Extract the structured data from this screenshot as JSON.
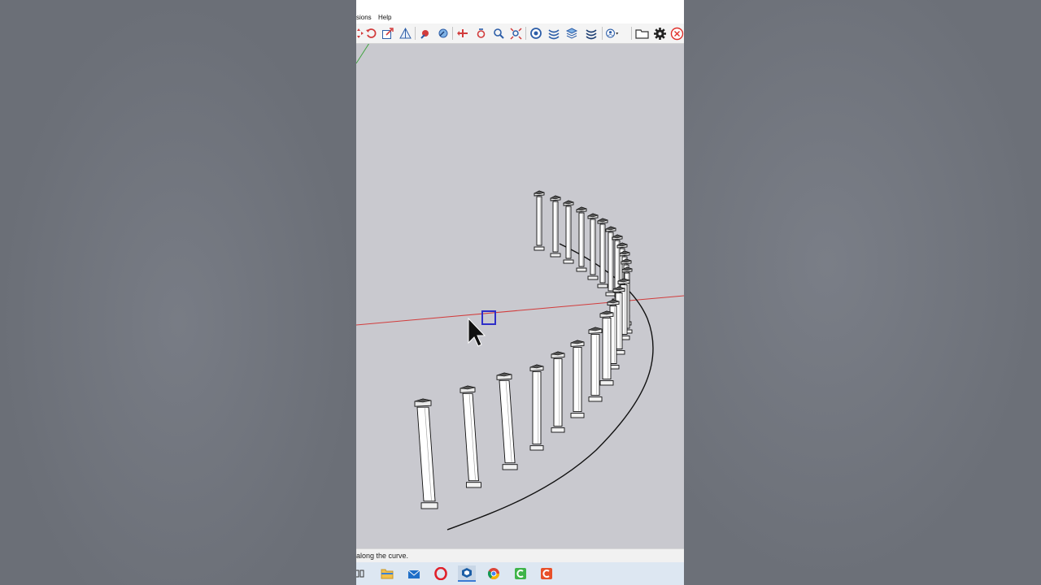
{
  "menu": {
    "extensions_fragment": "sions",
    "help": "Help"
  },
  "toolbar": {
    "icons": [
      "move-icon",
      "rotate-icon",
      "scale-icon",
      "section-plane-icon",
      "look-around-icon",
      "walk-icon",
      "previous-view-icon",
      "orbit-icon",
      "zoom-icon",
      "zoom-extents-icon",
      "warehouse-icon",
      "extension-warehouse-icon",
      "layers-icon",
      "outliner-icon",
      "account-icon",
      "open-folder-icon",
      "settings-icon",
      "close-icon"
    ]
  },
  "status": {
    "text": "along the curve."
  },
  "taskbar": {
    "apps": [
      "task-view-icon",
      "file-explorer-icon",
      "mail-icon",
      "opera-icon",
      "sketchup-icon",
      "chrome-icon",
      "camtasia-icon",
      "camtasia-recorder-icon"
    ]
  },
  "colors": {
    "red_axis": "#d23c3c",
    "green_axis": "#3fa33f",
    "selection_blue": "#2e2ec8",
    "close_red": "#e0302a"
  }
}
